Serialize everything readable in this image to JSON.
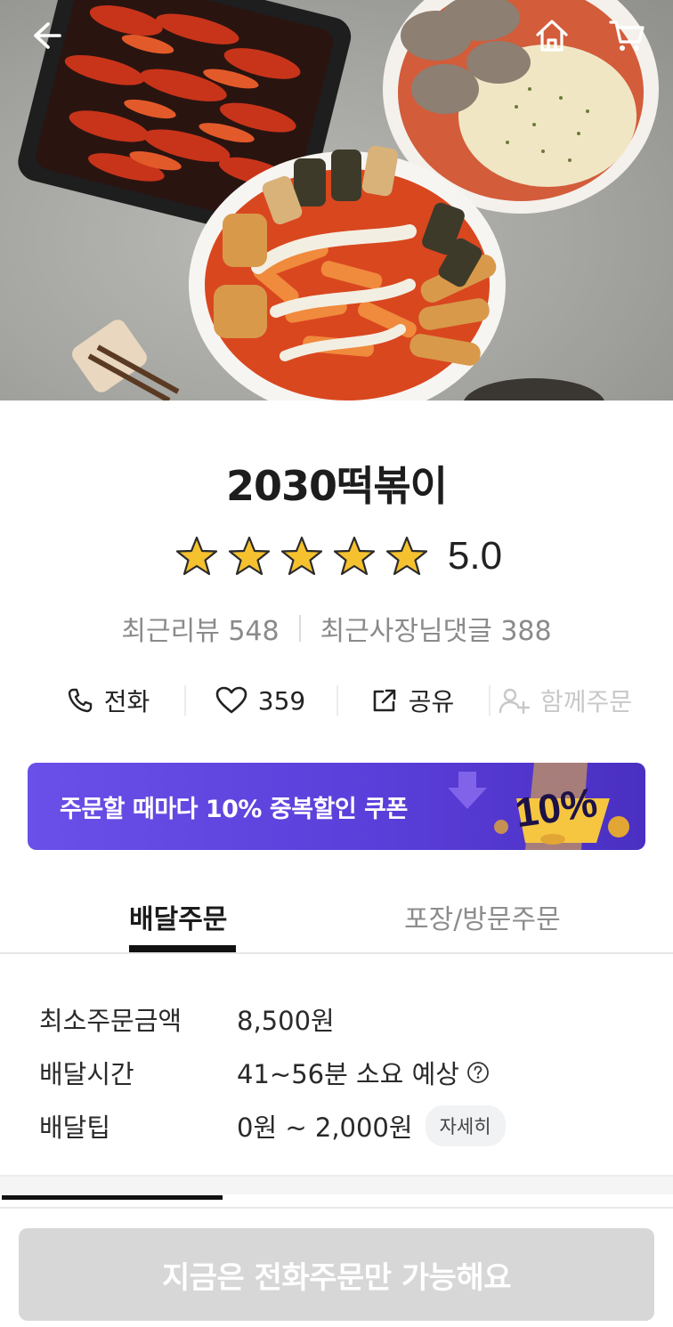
{
  "header": {
    "back_icon": "arrow-left-icon",
    "home_icon": "home-icon",
    "cart_icon": "cart-icon"
  },
  "store": {
    "name": "2030떡볶이",
    "rating": "5.0",
    "stars": 5,
    "recent_reviews_label": "최근리뷰 548",
    "owner_replies_label": "최근사장님댓글 388"
  },
  "actions": {
    "call": "전화",
    "likes": "359",
    "share": "공유",
    "group_order": "함께주문"
  },
  "coupon": {
    "text": "주문할 때마다 10% 중복할인 쿠폰",
    "badge": "10%"
  },
  "tabs": {
    "delivery": "배달주문",
    "pickup": "포장/방문주문"
  },
  "delivery_info": {
    "min_order_label": "최소주문금액",
    "min_order_value": "8,500원",
    "time_label": "배달시간",
    "time_value": "41~56분 소요 예상",
    "tip_label": "배달팁",
    "tip_value": "0원 ~ 2,000원",
    "detail_button": "자세히"
  },
  "cta": {
    "label": "지금은 전화주문만 가능해요"
  },
  "colors": {
    "coupon_bg": "#5b3fda",
    "star": "#f5c12e",
    "cta_disabled": "#d7d7d7"
  }
}
